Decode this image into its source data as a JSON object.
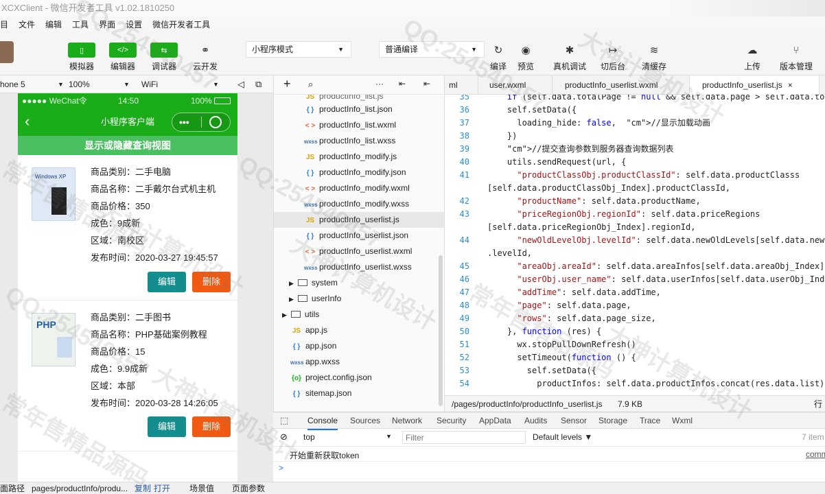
{
  "app": {
    "title": "XCXClient - 微信开发者工具 v1.02.1810250"
  },
  "menu": [
    "目",
    "文件",
    "编辑",
    "工具",
    "界面",
    "设置",
    "微信开发者工具"
  ],
  "toolbar": {
    "mode_buttons": [
      {
        "label": "模拟器",
        "icon": "phone-icon"
      },
      {
        "label": "编辑器",
        "icon": "code-icon"
      },
      {
        "label": "调试器",
        "icon": "debug-icon"
      },
      {
        "label": "云开发",
        "icon": "cloud-link-icon"
      }
    ],
    "mode_select": "小程序模式",
    "compile_select": "普通编译",
    "action_buttons": [
      "编译",
      "预览",
      "真机调试",
      "切后台",
      "清缓存"
    ],
    "right_buttons": [
      "上传",
      "版本管理"
    ]
  },
  "device": {
    "model": "hone 5",
    "zoom": "100%",
    "network": "WiFi"
  },
  "phone": {
    "status_left": "●●●●● WeChat令",
    "status_time": "14:50",
    "status_right": "100%",
    "nav_title": "小程序客户端",
    "nav_menu": "•••",
    "toggle_label": "显示或隐藏查询视图",
    "products": [
      {
        "category": "商品类别：二手电脑",
        "name": "商品名称：二手戴尔台式机主机",
        "price": "商品价格：350",
        "condition": "成色：9成新",
        "region": "区域：南校区",
        "time": "发布时间：2020-03-27 19:45:57",
        "thumb_text": "Windows XP",
        "edit": "编辑",
        "delete": "删除"
      },
      {
        "category": "商品类别：二手图书",
        "name": "商品名称：PHP基础案例教程",
        "price": "商品价格：15",
        "condition": "成色：9.9成新",
        "region": "区域：本部",
        "time": "发布时间：2020-03-28 14:26:05",
        "thumb_text": "PHP",
        "edit": "编辑",
        "delete": "删除"
      }
    ]
  },
  "tree": {
    "items": [
      {
        "icon": "{ }",
        "label": "productInfo_list.json"
      },
      {
        "icon": "< >",
        "label": "productInfo_list.wxml"
      },
      {
        "icon": "wxss",
        "label": "productInfo_list.wxss"
      },
      {
        "icon": "JS",
        "label": "productInfo_modify.js"
      },
      {
        "icon": "{ }",
        "label": "productInfo_modify.json"
      },
      {
        "icon": "< >",
        "label": "productInfo_modify.wxml"
      },
      {
        "icon": "wxss",
        "label": "productInfo_modify.wxss"
      },
      {
        "icon": "JS",
        "label": "productInfo_userlist.js"
      },
      {
        "icon": "{ }",
        "label": "productInfo_userlist.json"
      },
      {
        "icon": "< >",
        "label": "productInfo_userlist.wxml"
      },
      {
        "icon": "wxss",
        "label": "productInfo_userlist.wxss"
      }
    ],
    "folders": [
      "system",
      "userInfo",
      "utils"
    ],
    "root_files": [
      {
        "icon": "JS",
        "label": "app.js"
      },
      {
        "icon": "{ }",
        "label": "app.json"
      },
      {
        "icon": "wxss",
        "label": "app.wxss"
      },
      {
        "icon": "{o}",
        "label": "project.config.json"
      },
      {
        "icon": "{ }",
        "label": "sitemap.json"
      }
    ]
  },
  "editor": {
    "tabs": [
      "ml",
      "user.wxml",
      "productInfo_userlist.wxml",
      "productInfo_userlist.js"
    ],
    "lines": [
      {
        "n": "35",
        "text": "    if (self.data.totalPage != null && self.data.page > self.data.tot"
      },
      {
        "n": "36",
        "text": "    self.setData({"
      },
      {
        "n": "37",
        "text": "      loading_hide: false,  //显示加载动画"
      },
      {
        "n": "38",
        "text": "    })"
      },
      {
        "n": "39",
        "text": "    //提交查询参数到服务器查询数据列表"
      },
      {
        "n": "40",
        "text": "    utils.sendRequest(url, {"
      },
      {
        "n": "41",
        "text": "      \"productClassObj.productClassId\": self.data.productClasss"
      },
      {
        "n": "",
        "text": "[self.data.productClassObj_Index].productClassId,"
      },
      {
        "n": "42",
        "text": "      \"productName\": self.data.productName,"
      },
      {
        "n": "43",
        "text": "      \"priceRegionObj.regionId\": self.data.priceRegions"
      },
      {
        "n": "",
        "text": "[self.data.priceRegionObj_Index].regionId,"
      },
      {
        "n": "44",
        "text": "      \"newOldLevelObj.levelId\": self.data.newOldLevels[self.data.newO"
      },
      {
        "n": "",
        "text": ".levelId,"
      },
      {
        "n": "45",
        "text": "      \"areaObj.areaId\": self.data.areaInfos[self.data.areaObj_Index]."
      },
      {
        "n": "46",
        "text": "      \"userObj.user_name\": self.data.userInfos[self.data.userObj_Inde"
      },
      {
        "n": "47",
        "text": "      \"addTime\": self.data.addTime,"
      },
      {
        "n": "48",
        "text": "      \"page\": self.data.page,"
      },
      {
        "n": "49",
        "text": "      \"rows\": self.data.page_size,"
      },
      {
        "n": "50",
        "text": "    }, function (res) {"
      },
      {
        "n": "51",
        "text": "      wx.stopPullDownRefresh()"
      },
      {
        "n": "52",
        "text": "      setTimeout(function () {"
      },
      {
        "n": "53",
        "text": "        self.setData({"
      },
      {
        "n": "54",
        "text": "          productInfos: self.data.productInfos.concat(res.data.list),"
      }
    ],
    "status_path": "/pages/productInfo/productInfo_userlist.js",
    "status_size": "7.9 KB",
    "status_right": "行"
  },
  "devtools": {
    "tabs": [
      "Console",
      "Sources",
      "Network",
      "Security",
      "AppData",
      "Audits",
      "Sensor",
      "Storage",
      "Trace",
      "Wxml"
    ],
    "context": "top",
    "filter_placeholder": "Filter",
    "levels": "Default levels ▼",
    "hidden_count": "7 item",
    "log_message": "开始重新获取token",
    "log_source": "comm",
    "prompt": ">"
  },
  "bottom": {
    "label": "面路径",
    "path": "pages/productInfo/produ...",
    "copy": "复制",
    "open": "打开",
    "scene": "场景值",
    "params": "页面参数"
  },
  "watermark": {
    "texts": [
      "QQ:254540457",
      "大神计算机设计",
      "常年售精品源码"
    ]
  }
}
